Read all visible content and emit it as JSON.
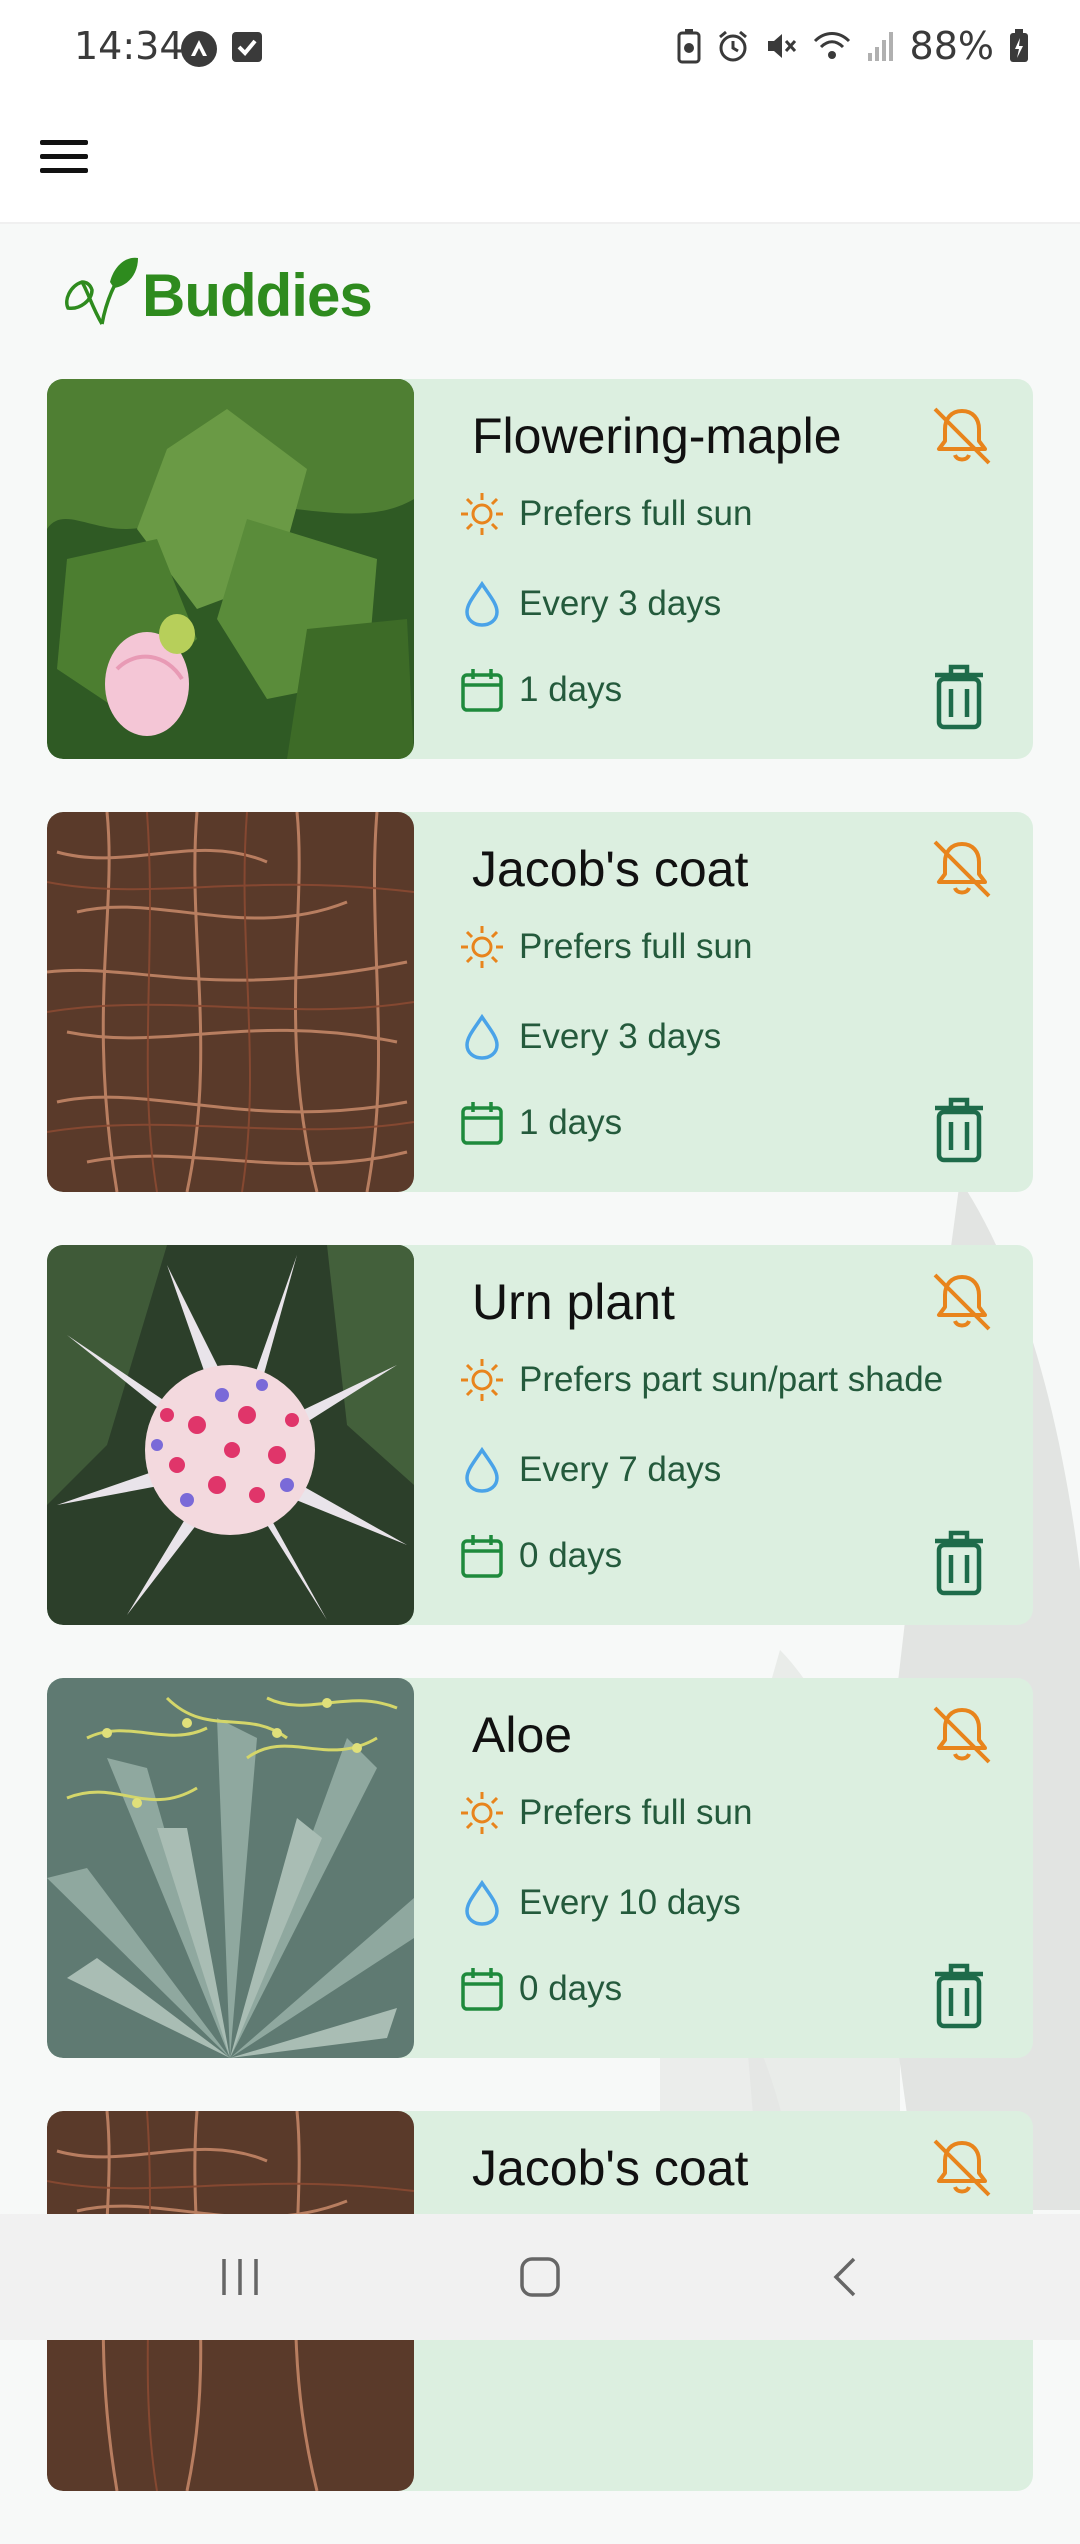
{
  "status_bar": {
    "time": "14:34",
    "battery": "88%"
  },
  "brand": {
    "name": "Buddies",
    "color": "#2e8b1e"
  },
  "colors": {
    "card_bg": "#dcefe0",
    "sun_icon": "#e8841c",
    "water_icon": "#4aa3e8",
    "calendar_icon": "#1e8a3c",
    "bell_off_icon": "#e8841c",
    "trash_icon": "#1e6b4a"
  },
  "plants": [
    {
      "name": "Flowering-maple",
      "sun": "Prefers full sun",
      "water": "Every 3 days",
      "days": "1 days",
      "photo": "flowering-maple-photo"
    },
    {
      "name": "Jacob's coat",
      "sun": "Prefers full sun",
      "water": "Every 3 days",
      "days": "1 days",
      "photo": "jacobs-coat-photo"
    },
    {
      "name": "Urn plant",
      "sun": "Prefers part sun/part shade",
      "water": "Every 7 days",
      "days": "0 days",
      "photo": "urn-plant-photo"
    },
    {
      "name": "Aloe",
      "sun": "Prefers full sun",
      "water": "Every 10 days",
      "days": "0 days",
      "photo": "aloe-photo"
    },
    {
      "name": "Jacob's coat",
      "sun": "",
      "water": "",
      "days": "",
      "photo": "jacobs-coat-photo"
    }
  ],
  "icons": {
    "menu": "hamburger-menu-icon",
    "bell": "bell-off-icon",
    "trash": "trash-icon",
    "sun": "sun-icon",
    "water": "water-drop-icon",
    "calendar": "calendar-icon"
  }
}
